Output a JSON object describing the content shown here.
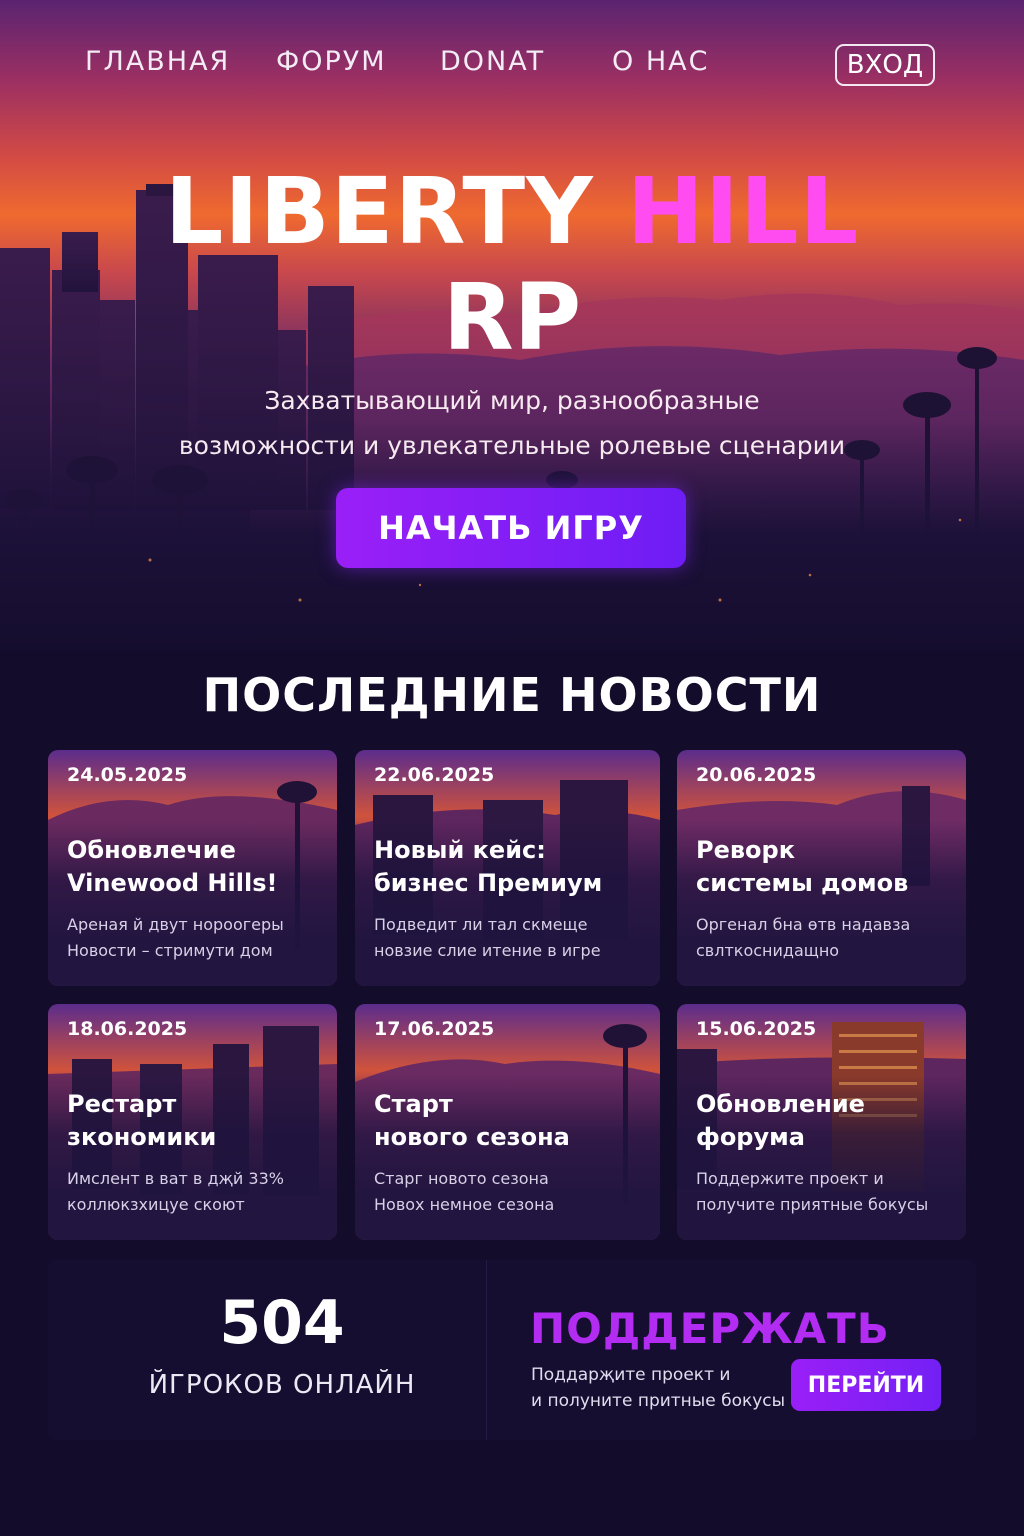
{
  "nav": {
    "items": [
      {
        "label": "ГЛАВНАЯ"
      },
      {
        "label": "ФОРУМ"
      },
      {
        "label": "DONAT"
      },
      {
        "label": "О НАС"
      }
    ],
    "login_label": "ВХОД"
  },
  "hero": {
    "title_main": "LIBERTY",
    "title_accent": "HILL",
    "title_line2": "RP",
    "tagline_line1": "Захватывающий мир, разнообразные",
    "tagline_line2": "возможности и увлекательные ролевые сценарии",
    "cta_label": "НАЧАТЬ ИГРУ"
  },
  "news": {
    "heading": "ПОСЛЕДНИЕ НОВОСТИ",
    "items": [
      {
        "date": "24.05.2025",
        "title_line1": "Обновлечие",
        "title_line2": "Vinewood Hills!",
        "desc_line1": "Ареная й двут нороогеры",
        "desc_line2": "Новости – стримути дом"
      },
      {
        "date": "22.06.2025",
        "title_line1": "Новый кейс:",
        "title_line2": "бизнес Премиум",
        "desc_line1": "Подведит ли тал скмеще",
        "desc_line2": "новзие слие итение в игре"
      },
      {
        "date": "20.06.2025",
        "title_line1": "Реворк",
        "title_line2": "системы домов",
        "desc_line1": "Оргенал бна өтв надавза",
        "desc_line2": "свлткоснидащно"
      },
      {
        "date": "18.06.2025",
        "title_line1": "Рестарт",
        "title_line2": "зкономики",
        "desc_line1": "Имслент в ват в дҗй 33%",
        "desc_line2": "коллюкзхицуе скоют"
      },
      {
        "date": "17.06.2025",
        "title_line1": "Старт",
        "title_line2": "нового сезона",
        "desc_line1": "Старг новото сезона",
        "desc_line2": "Новох немное сезона"
      },
      {
        "date": "15.06.2025",
        "title_line1": "Обновление",
        "title_line2": "форума",
        "desc_line1": "Поддержите проект и",
        "desc_line2": "получите приятные бокусы"
      }
    ]
  },
  "stats": {
    "online_count": "504",
    "online_label": "ЙГРОКОВ ОНЛАЙН",
    "support_title": "ПОДДЕРЖАТЬ",
    "support_desc_line1": "Поддарҗите проект и",
    "support_desc_line2": "и полуните притные бокусы",
    "go_label": "ПЕРЕЙТИ"
  },
  "colors": {
    "accent_pink": "#ff4cf0",
    "button_purple": "#8a1ff7",
    "support_purple": "#b22cf2",
    "page_bg": "#130c2b"
  }
}
